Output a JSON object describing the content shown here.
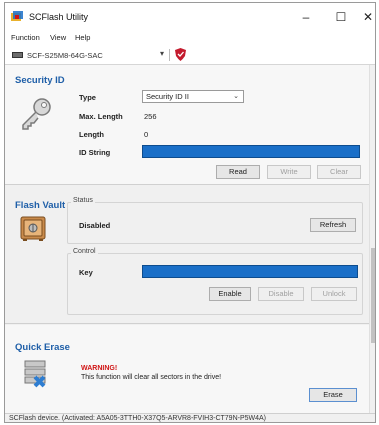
{
  "window": {
    "title": "SCFlash Utility",
    "minimize": "–",
    "maximize": "☐",
    "close": "✕"
  },
  "menu": [
    {
      "label": "Function"
    },
    {
      "label": "View"
    },
    {
      "label": "Help"
    }
  ],
  "device": {
    "name": "SCF-S25M8-64G-SAC"
  },
  "security_id": {
    "title": "Security ID",
    "type_label": "Type",
    "type_value": "Security ID II",
    "max_length_label": "Max. Length",
    "max_length_value": "256",
    "length_label": "Length",
    "length_value": "0",
    "id_string_label": "ID String",
    "buttons": {
      "read": "Read",
      "write": "Write",
      "clear": "Clear"
    }
  },
  "flash_vault": {
    "title": "Flash Vault",
    "status_group": "Status",
    "status_value": "Disabled",
    "refresh": "Refresh",
    "control_group": "Control",
    "key_label": "Key",
    "buttons": {
      "enable": "Enable",
      "disable": "Disable",
      "unlock": "Unlock"
    }
  },
  "quick_erase": {
    "title": "Quick Erase",
    "warning": "WARNING!",
    "message": "This function will clear all sectors in the drive!",
    "erase": "Erase"
  },
  "statusbar": {
    "text": "SCFlash device. (Activated: A5A05-3TTH0-X37Q5-ARVR8-FVIH3-CT79N-P5W4A)"
  },
  "colors": {
    "accent": "#1f5fa8",
    "bar": "#1a6fc8",
    "warning": "#d01515"
  }
}
